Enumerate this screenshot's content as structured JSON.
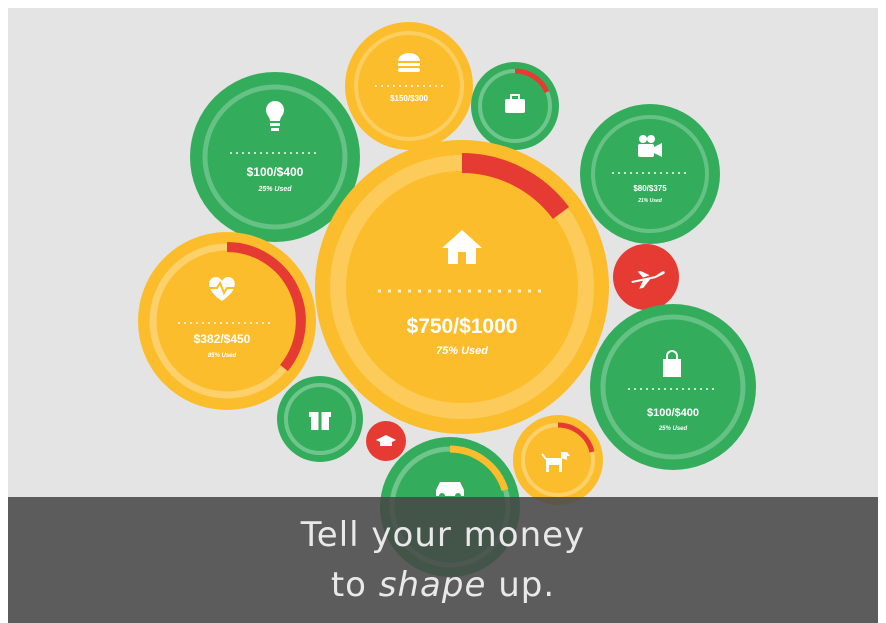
{
  "colors": {
    "background": "#e4e4e4",
    "green": "#33ad5c",
    "yellow": "#fbbd2b",
    "red": "#e63b33",
    "white": "#ffffff",
    "banner": "#464646"
  },
  "budgets": {
    "home": {
      "icon": "house-icon",
      "amount": "$750/$1000",
      "used": "75% Used",
      "progress": 0.75
    },
    "health": {
      "icon": "heart-pulse-icon",
      "amount": "$382/$450",
      "used": "85% Used",
      "progress": 0.85
    },
    "utilities": {
      "icon": "lightbulb-icon",
      "amount": "$100/$400",
      "used": "25% Used",
      "progress": 0.25
    },
    "food": {
      "icon": "burger-icon",
      "amount": "$150/$300",
      "progress": 0.5
    },
    "work": {
      "icon": "briefcase-icon",
      "progress": 0.2
    },
    "entertainment": {
      "icon": "camera-icon",
      "amount": "$80/$375",
      "used": "21% Used",
      "progress": 0.21
    },
    "travel": {
      "icon": "airplane-icon"
    },
    "shopping": {
      "icon": "shopping-bag-icon",
      "amount": "$100/$400",
      "used": "25% Used",
      "progress": 0.25
    },
    "gifts": {
      "icon": "gift-icon"
    },
    "education": {
      "icon": "graduation-cap-icon"
    },
    "auto": {
      "icon": "car-icon",
      "progress": 0.3
    },
    "pets": {
      "icon": "dog-icon",
      "progress": 0.3
    }
  },
  "caption": {
    "line1": "Tell your money",
    "line2_prefix": "to ",
    "line2_em": "shape",
    "line2_suffix": " up."
  }
}
